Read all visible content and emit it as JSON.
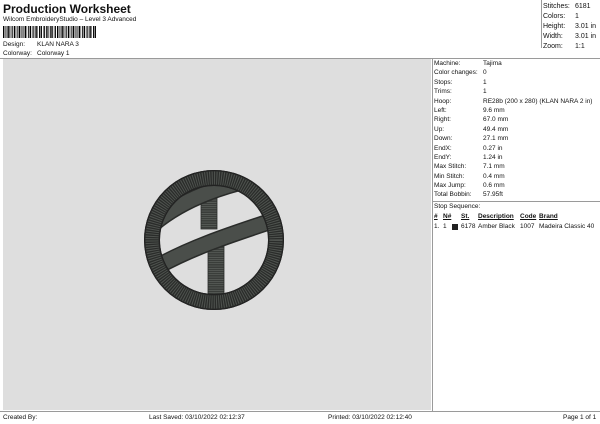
{
  "header": {
    "title": "Production Worksheet",
    "subtitle": "Wilcom EmbroideryStudio – Level 3 Advanced",
    "design_label": "Design:",
    "design_value": "KLAN NARA 3",
    "colorway_label": "Colorway:",
    "colorway_value": "Colorway 1"
  },
  "stats": [
    {
      "label": "Stitches:",
      "value": "6181"
    },
    {
      "label": "Colors:",
      "value": "1"
    },
    {
      "label": "Height:",
      "value": "3.01 in"
    },
    {
      "label": "Width:",
      "value": "3.01 in"
    },
    {
      "label": "Zoom:",
      "value": "1:1"
    }
  ],
  "machine_info": [
    {
      "label": "Machine:",
      "value": "Tajima"
    },
    {
      "label": "Color changes:",
      "value": "0"
    },
    {
      "label": "Stops:",
      "value": "1"
    },
    {
      "label": "Trims:",
      "value": "1"
    },
    {
      "label": "Hoop:",
      "value": "RE28b (200 x 280) (KLAN NARA 2 in)"
    },
    {
      "label": "Left:",
      "value": "9.6 mm"
    },
    {
      "label": "Right:",
      "value": "67.0 mm"
    },
    {
      "label": "Up:",
      "value": "49.4 mm"
    },
    {
      "label": "Down:",
      "value": "27.1 mm"
    },
    {
      "label": "EndX:",
      "value": "0.27 in"
    },
    {
      "label": "EndY:",
      "value": "1.24 in"
    },
    {
      "label": "Max Stitch:",
      "value": "7.1 mm"
    },
    {
      "label": "Min Stitch:",
      "value": "0.4 mm"
    },
    {
      "label": "Max Jump:",
      "value": "0.6 mm"
    },
    {
      "label": "Total Bobbin:",
      "value": "57.95ft"
    }
  ],
  "stop_sequence": {
    "title": "Stop Sequence:",
    "headers": [
      "#",
      "N#",
      "St.",
      "Description",
      "Code",
      "Brand"
    ],
    "rows": [
      {
        "index": "1.",
        "needle": "1",
        "swatch_color": "#222222",
        "stitches": "6178",
        "description": "Amber Black",
        "code": "1007",
        "brand": "Madeira Classic 40"
      }
    ]
  },
  "footer": {
    "created_by": "Created By:",
    "last_saved": "Last Saved: 03/10/2022 02:12:37",
    "printed": "Printed: 03/10/2022 02:12:40",
    "page": "Page 1 of 1"
  },
  "colors": {
    "canvas_bg": "#dedede",
    "thread": "#3a3d3a"
  }
}
